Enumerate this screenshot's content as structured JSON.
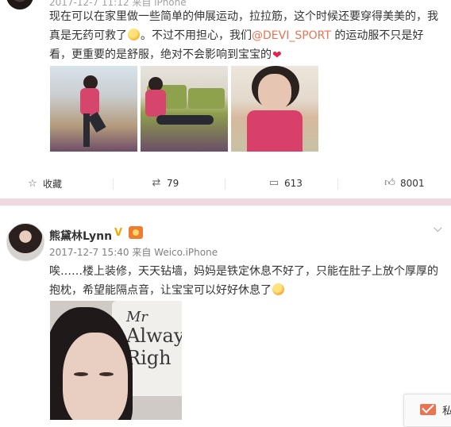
{
  "post1": {
    "meta": "2017-12-7 11:12 来自 iPhone",
    "text_lines": [
      {
        "before": "现在可以在家里做一些简单的伸展运动，拉拉筋，这个时候还要穿得美美的，我",
        "after": ""
      },
      {
        "before": "真是无药可救了",
        "after": "。不过不用担心，我们"
      },
      {
        "before": "的运动服不只是好",
        "after": ""
      },
      {
        "before": "看，更重要的是舒服，绝对不会影响到宝宝的",
        "after": ""
      }
    ],
    "mention": "@DEVI_SPORT",
    "emojis": [
      "smile-emoji",
      "heart-emoji"
    ],
    "actions": {
      "favorite": "收藏",
      "repost": "79",
      "comment": "613",
      "like": "8001"
    },
    "icons": {
      "favorite": "star-icon",
      "repost": "repost-icon",
      "comment": "comment-icon",
      "like": "thumbs-up-icon"
    }
  },
  "post2": {
    "name": "熊黛林Lynn",
    "vip": "V",
    "meta_time": "2017-12-7 15:40",
    "meta_from": "来自",
    "meta_source": "Weico.iPhone",
    "text_lines": [
      "唉……楼上装修，天天钻墙，妈妈是铁定休息不好了，只能在肚子上放个厚厚的",
      "抱枕，希望能隔点音，让宝宝可以好好休息了"
    ],
    "photo_text": [
      "Mr",
      "Alway",
      "Righ"
    ]
  },
  "widget": {
    "label": "私"
  },
  "colors": {
    "accent": "#eb7350",
    "separator": "#f0d8e1",
    "vip": "#f6a800"
  }
}
